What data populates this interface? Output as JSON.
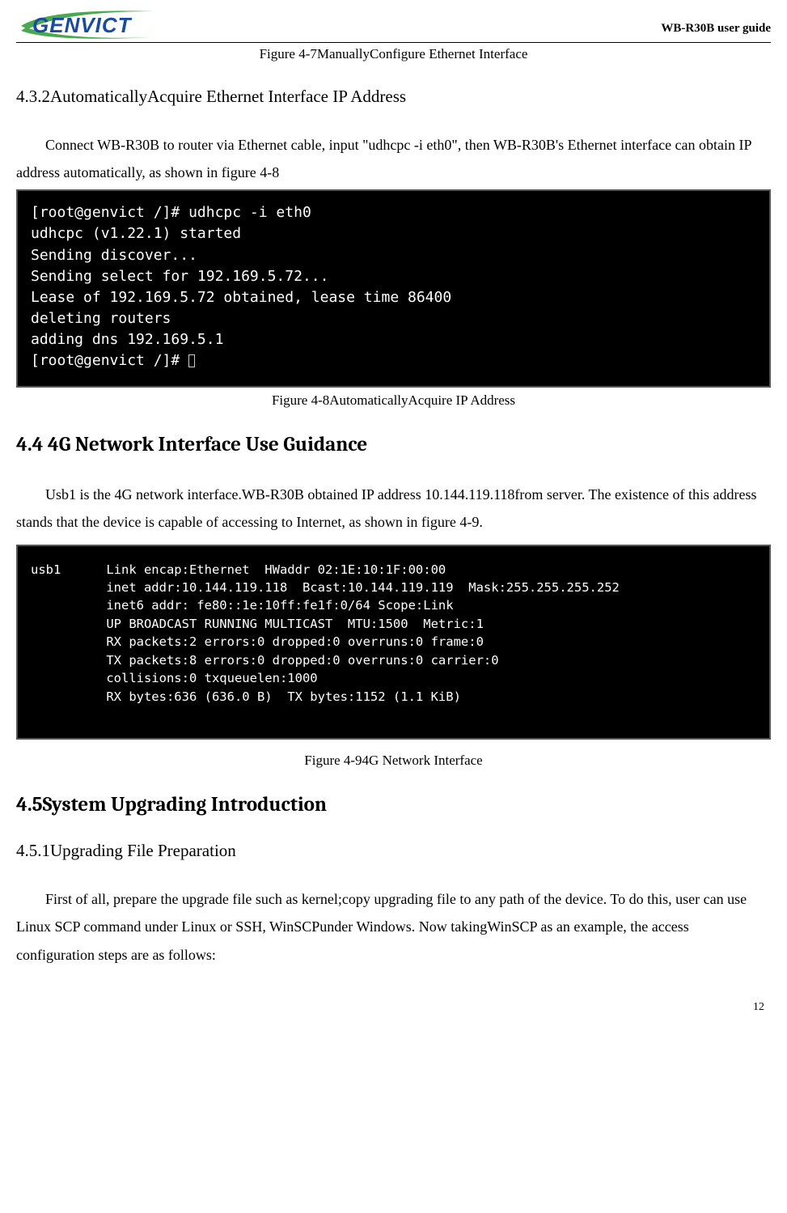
{
  "header": {
    "brand": "GENVICT",
    "rightText": "WB-R30B user guide"
  },
  "captions": {
    "fig47": "Figure 4-7ManuallyConfigure Ethernet Interface",
    "fig48": "Figure 4-8AutomaticallyAcquire IP Address",
    "fig49": "Figure 4-94G Network Interface"
  },
  "headings": {
    "sub432": "4.3.2AutomaticallyAcquire Ethernet Interface IP Address",
    "sec44": "4.4 4G Network Interface Use Guidance",
    "sec45": "4.5System Upgrading Introduction",
    "sub451": "4.5.1Upgrading File Preparation"
  },
  "paragraphs": {
    "p432": "Connect WB-R30B to router via Ethernet cable, input \"udhcpc -i eth0\", then WB-R30B's Ethernet interface can obtain IP address automatically, as shown in figure 4-8",
    "p44": "Usb1 is the 4G network interface.WB-R30B obtained IP address 10.144.119.118from server. The existence of this address stands that the device is capable of accessing to Internet, as shown in figure 4-9.",
    "p451": "First of all, prepare the upgrade file such as kernel;copy upgrading file to any path of the device. To do this, user can use Linux SCP command under Linux or SSH, WinSCPunder Windows. Now takingWinSCP as an example, the access configuration steps are as follows:"
  },
  "terminal1": {
    "l1": "[root@genvict /]# udhcpc -i eth0",
    "l2": "udhcpc (v1.22.1) started",
    "l3": "Sending discover...",
    "l4": "Sending select for 192.169.5.72...",
    "l5": "Lease of 192.169.5.72 obtained, lease time 86400",
    "l6": "deleting routers",
    "l7": "adding dns 192.169.5.1",
    "l8": "[root@genvict /]# "
  },
  "terminal2": {
    "l1": "usb1      Link encap:Ethernet  HWaddr 02:1E:10:1F:00:00",
    "l2": "          inet addr:10.144.119.118  Bcast:10.144.119.119  Mask:255.255.255.252",
    "l3": "          inet6 addr: fe80::1e:10ff:fe1f:0/64 Scope:Link",
    "l4": "          UP BROADCAST RUNNING MULTICAST  MTU:1500  Metric:1",
    "l5": "          RX packets:2 errors:0 dropped:0 overruns:0 frame:0",
    "l6": "          TX packets:8 errors:0 dropped:0 overruns:0 carrier:0",
    "l7": "          collisions:0 txqueuelen:1000",
    "l8": "          RX bytes:636 (636.0 B)  TX bytes:1152 (1.1 KiB)"
  },
  "pageNumber": "12"
}
